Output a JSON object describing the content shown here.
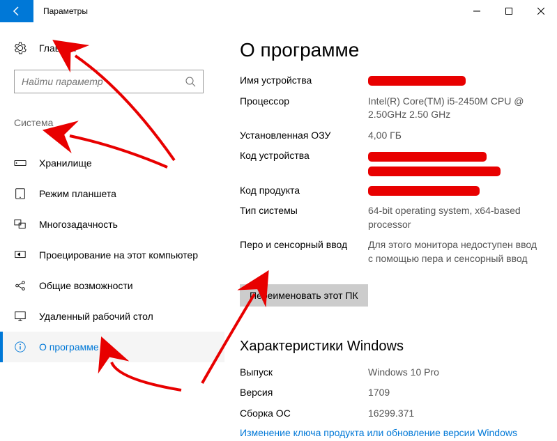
{
  "titlebar": {
    "title": "Параметры"
  },
  "sidebar": {
    "home_label": "Главная",
    "search_placeholder": "Найти параметр",
    "category": "Система",
    "items": [
      {
        "label": "Хранилище"
      },
      {
        "label": "Режим планшета"
      },
      {
        "label": "Многозадачность"
      },
      {
        "label": "Проецирование на этот компьютер"
      },
      {
        "label": "Общие возможности"
      },
      {
        "label": "Удаленный рабочий стол"
      },
      {
        "label": "О программе"
      }
    ]
  },
  "main": {
    "title": "О программе",
    "specs": {
      "device_name_label": "Имя устройства",
      "processor_label": "Процессор",
      "processor_value": "Intel(R) Core(TM) i5-2450M CPU @ 2.50GHz   2.50 GHz",
      "ram_label": "Установленная ОЗУ",
      "ram_value": "4,00 ГБ",
      "device_id_label": "Код устройства",
      "product_id_label": "Код продукта",
      "system_type_label": "Тип системы",
      "system_type_value": "64-bit operating system, x64-based processor",
      "pen_label": "Перо и сенсорный ввод",
      "pen_value": "Для этого монитора недоступен ввод с помощью пера и сенсорный ввод"
    },
    "rename_button": "Переименовать этот ПК",
    "windows_specs_title": "Характеристики Windows",
    "windows": {
      "edition_label": "Выпуск",
      "edition_value": "Windows 10 Pro",
      "version_label": "Версия",
      "version_value": "1709",
      "build_label": "Сборка ОС",
      "build_value": "16299.371"
    },
    "link_text": "Изменение ключа продукта или обновление версии Windows"
  }
}
